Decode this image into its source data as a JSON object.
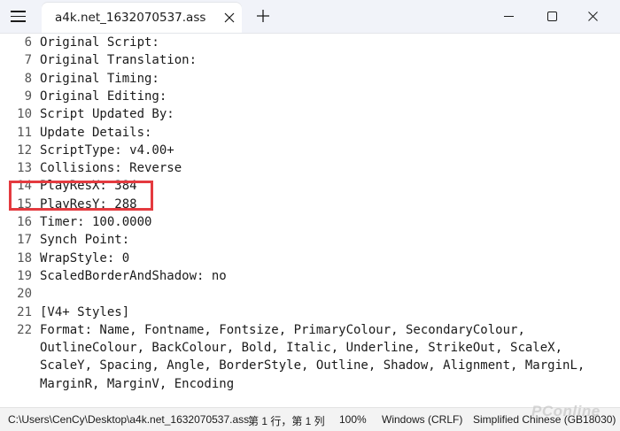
{
  "tab": {
    "title": "a4k.net_1632070537.ass"
  },
  "editor": {
    "lines": [
      {
        "number": "6",
        "text": "Original Script:"
      },
      {
        "number": "7",
        "text": "Original Translation:"
      },
      {
        "number": "8",
        "text": "Original Timing:"
      },
      {
        "number": "9",
        "text": "Original Editing:"
      },
      {
        "number": "10",
        "text": "Script Updated By:"
      },
      {
        "number": "11",
        "text": "Update Details:"
      },
      {
        "number": "12",
        "text": "ScriptType: v4.00+"
      },
      {
        "number": "13",
        "text": "Collisions: Reverse"
      },
      {
        "number": "14",
        "text": "PlayResX: 384"
      },
      {
        "number": "15",
        "text": "PlayResY: 288"
      },
      {
        "number": "16",
        "text": "Timer: 100.0000"
      },
      {
        "number": "17",
        "text": "Synch Point:"
      },
      {
        "number": "18",
        "text": "WrapStyle: 0"
      },
      {
        "number": "19",
        "text": "ScaledBorderAndShadow: no"
      },
      {
        "number": "20",
        "text": ""
      },
      {
        "number": "21",
        "text": "[V4+ Styles]"
      },
      {
        "number": "22",
        "text": "Format: Name, Fontname, Fontsize, PrimaryColour, SecondaryColour,"
      },
      {
        "number": "",
        "text": "OutlineColour, BackColour, Bold, Italic, Underline, StrikeOut, ScaleX,"
      },
      {
        "number": "",
        "text": "ScaleY, Spacing, Angle, BorderStyle, Outline, Shadow, Alignment, MarginL,"
      },
      {
        "number": "",
        "text": "MarginR, MarginV, Encoding"
      }
    ],
    "highlight_color": "#e43a3f"
  },
  "statusbar": {
    "path": "C:\\Users\\CenCy\\Desktop\\a4k.net_1632070537.ass",
    "position": "第 1 行，第 1 列",
    "zoom": "100%",
    "line_ending": "Windows (CRLF)",
    "encoding": "Simplified Chinese (GB18030)"
  },
  "watermark": "PConline",
  "icons": {
    "menu": "hamburger-menu-icon",
    "tab_close": "close-icon",
    "new_tab": "plus-icon",
    "minimize": "minimize-icon",
    "maximize": "maximize-icon",
    "close": "close-icon"
  }
}
